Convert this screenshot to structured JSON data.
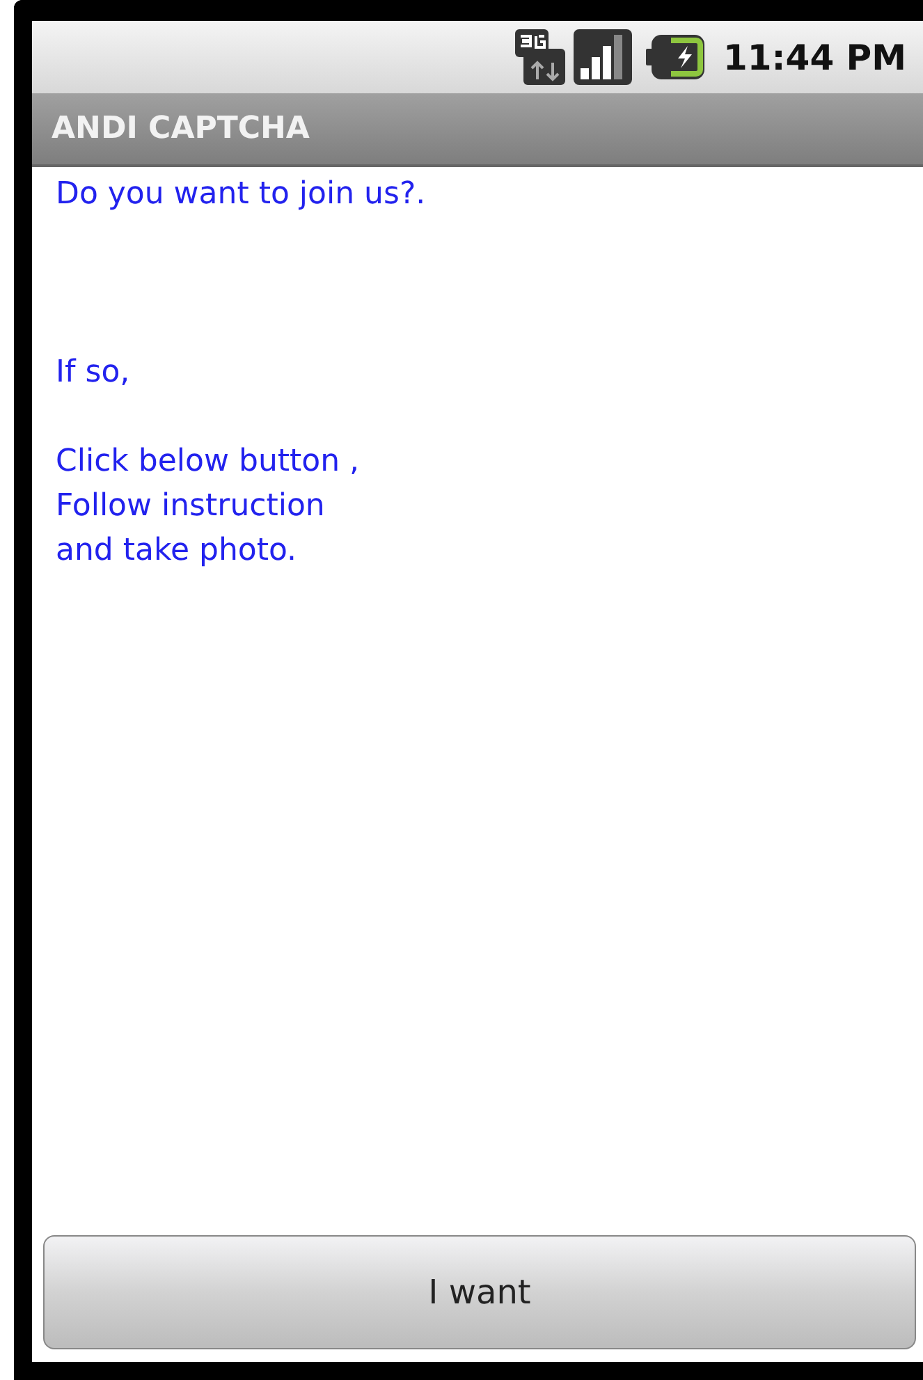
{
  "status_bar": {
    "time": "11:44 PM"
  },
  "title_bar": {
    "title": "ANDI CAPTCHA"
  },
  "message": "Do you want to join us?.\n\n\n\nIf so,\n\nClick below button ,\nFollow instruction\nand take photo.",
  "button": {
    "label": "I want"
  }
}
